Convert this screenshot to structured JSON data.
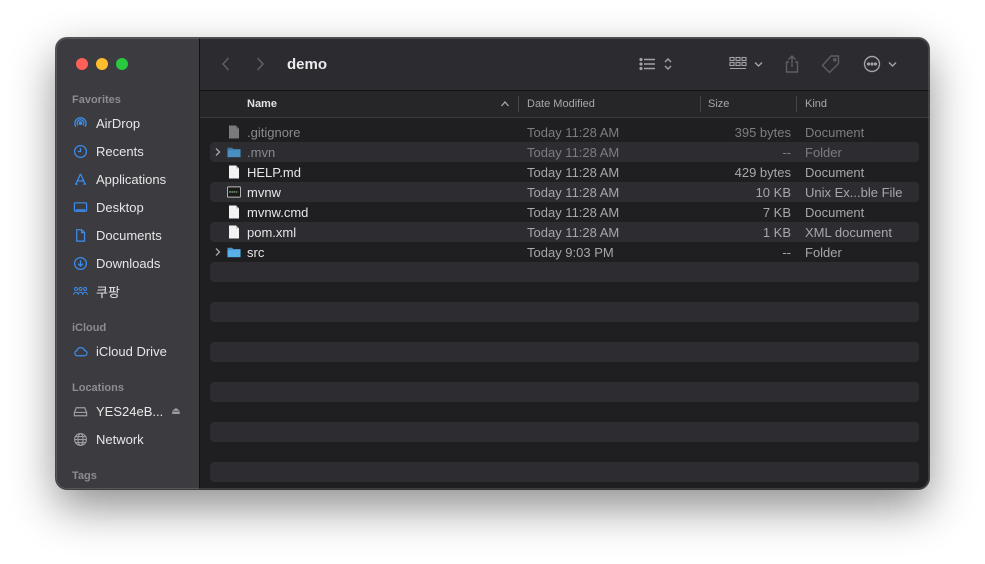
{
  "window": {
    "title": "demo"
  },
  "sidebar": {
    "favorites_title": "Favorites",
    "favorites": [
      {
        "label": "AirDrop",
        "icon": "airdrop-icon"
      },
      {
        "label": "Recents",
        "icon": "clock-icon"
      },
      {
        "label": "Applications",
        "icon": "applications-icon"
      },
      {
        "label": "Desktop",
        "icon": "desktop-icon"
      },
      {
        "label": "Documents",
        "icon": "document-icon"
      },
      {
        "label": "Downloads",
        "icon": "download-icon"
      },
      {
        "label": "쿠팡",
        "icon": "shared-users-icon"
      }
    ],
    "icloud_title": "iCloud",
    "icloud": [
      {
        "label": "iCloud Drive",
        "icon": "cloud-icon"
      }
    ],
    "locations_title": "Locations",
    "locations": [
      {
        "label": "YES24eB...",
        "icon": "drive-icon",
        "eject": "⏏"
      },
      {
        "label": "Network",
        "icon": "globe-icon"
      }
    ],
    "tags_title": "Tags"
  },
  "columns": {
    "name": "Name",
    "date": "Date Modified",
    "size": "Size",
    "kind": "Kind"
  },
  "files": [
    {
      "name": ".gitignore",
      "date": "Today 11:28 AM",
      "size": "395 bytes",
      "kind": "Document",
      "type": "doc",
      "hidden": true
    },
    {
      "name": ".mvn",
      "date": "Today 11:28 AM",
      "size": "--",
      "kind": "Folder",
      "type": "folder",
      "hidden": true
    },
    {
      "name": "HELP.md",
      "date": "Today 11:28 AM",
      "size": "429 bytes",
      "kind": "Document",
      "type": "doc"
    },
    {
      "name": "mvnw",
      "date": "Today 11:28 AM",
      "size": "10 KB",
      "kind": "Unix Ex...ble File",
      "type": "exec"
    },
    {
      "name": "mvnw.cmd",
      "date": "Today 11:28 AM",
      "size": "7 KB",
      "kind": "Document",
      "type": "doc"
    },
    {
      "name": "pom.xml",
      "date": "Today 11:28 AM",
      "size": "1 KB",
      "kind": "XML document",
      "type": "doc"
    },
    {
      "name": "src",
      "date": "Today 9:03 PM",
      "size": "--",
      "kind": "Folder",
      "type": "folder"
    }
  ],
  "colors": {
    "accent": "#3b8ef0",
    "folder": "#5ab0e8",
    "traffic_red": "#fe5f57",
    "traffic_yellow": "#febc2e",
    "traffic_green": "#28c840"
  }
}
